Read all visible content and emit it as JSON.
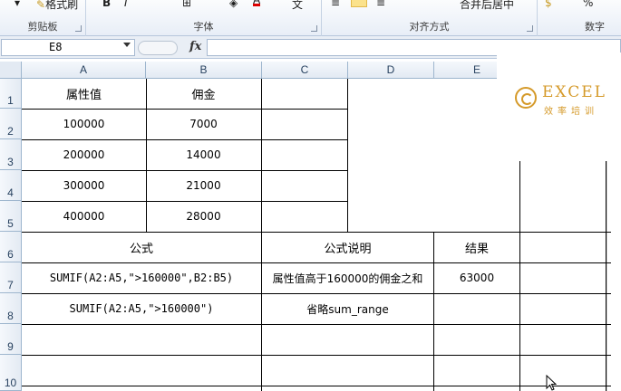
{
  "ribbon": {
    "format_painter": "格式刷",
    "font_group": "字体",
    "clipboard_group": "剪贴板",
    "align_group": "对齐方式",
    "number_group": "数字",
    "font_color_letter": "A",
    "merge_fragment": "合并后居中",
    "number_fragment": "%"
  },
  "formula_bar": {
    "name_box": "E8",
    "fx_label": "fx",
    "formula": ""
  },
  "columns": [
    "A",
    "B",
    "C",
    "D",
    "E"
  ],
  "rows": [
    "1",
    "2",
    "3",
    "4",
    "5",
    "6",
    "7",
    "8",
    "9",
    "10"
  ],
  "table": {
    "header_a": "属性值",
    "header_b": "佣金",
    "data": [
      {
        "a": "100000",
        "b": "7000"
      },
      {
        "a": "200000",
        "b": "14000"
      },
      {
        "a": "300000",
        "b": "21000"
      },
      {
        "a": "400000",
        "b": "28000"
      }
    ],
    "formula_header": "公式",
    "desc_header": "公式说明",
    "result_header": "结果",
    "formula1": "SUMIF(A2:A5,\">160000\",B2:B5)",
    "desc1": "属性值高于160000的佣金之和",
    "result1": "63000",
    "formula2": "SUMIF(A2:A5,\">160000\")",
    "desc2": "省略sum_range"
  },
  "logo": {
    "main": "EXCEL",
    "sub": "效率培训"
  },
  "colors": {
    "accent_gold": "#d59a2a",
    "ribbon_bg": "#e8eef7",
    "header_text": "#27415f"
  }
}
